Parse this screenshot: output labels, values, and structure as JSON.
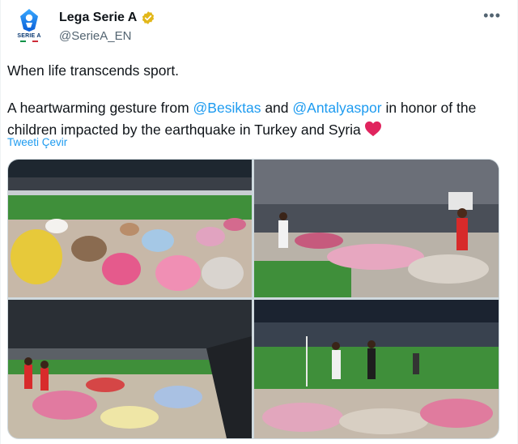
{
  "account": {
    "display_name": "Lega Serie A",
    "handle": "@SerieA_EN",
    "avatar_text": "SERIE A",
    "verified_color": "#e2b719"
  },
  "tweet": {
    "line1": "When life transcends sport.",
    "text_a": "A heartwarming gesture from ",
    "mention_1": "@Besiktas",
    "text_b": " and ",
    "mention_2": "@Antalyaspor",
    "text_c": " in honor of the children impacted by the earthquake in Turkey and Syria",
    "emoji": "red-heart",
    "translate_link": "Tweeti Çevir"
  },
  "more_menu": {
    "label": "•••"
  },
  "colors": {
    "link": "#1d9bf0",
    "text": "#0f1419",
    "muted": "#536471",
    "heart": "#e0245e",
    "pitch": "#3f8f3a"
  },
  "media": {
    "count": 4
  }
}
